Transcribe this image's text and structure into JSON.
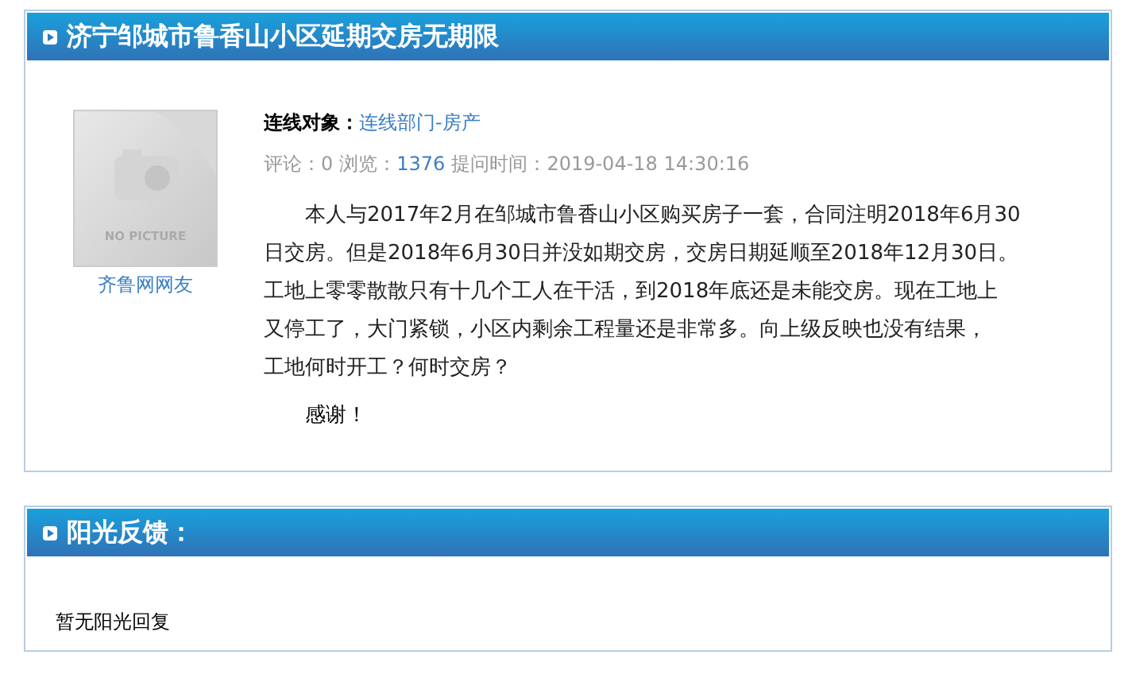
{
  "question": {
    "title": "济宁邹城市鲁香山小区延期交房无期限",
    "author": "齐鲁网网友",
    "avatar": {
      "caption": "NO PICTURE"
    },
    "target_label": "连线对象：",
    "target": "连线部门-房产",
    "meta": [
      {
        "label": "评论：",
        "value": "0",
        "kind": "plain"
      },
      {
        "label": "浏览：",
        "value": "1376",
        "kind": "link"
      },
      {
        "label": "提问时间：",
        "value": "2019-04-18 14:30:16",
        "kind": "plain"
      }
    ],
    "body_lines": [
      "本人与2017年2月在邹城市鲁香山小区购买房子一套，合同注明2018年6月30",
      "日交房。但是2018年6月30日并没如期交房，交房日期延顺至2018年12月30日。",
      "工地上零零散散只有十几个工人在干活，到2018年底还是未能交房。现在工地上",
      "又停工了，大门紧锁，小区内剩余工程量还是非常多。向上级反映也没有结果，",
      "工地何时开工？何时交房？"
    ],
    "closing": "感谢！"
  },
  "reply": {
    "title": "阳光反馈：",
    "text": "暂无阳光回复"
  }
}
